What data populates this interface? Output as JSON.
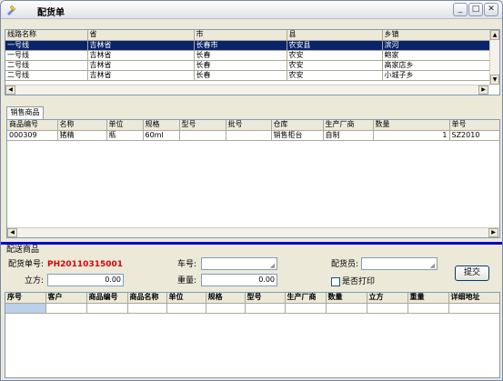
{
  "window": {
    "title": "配货单",
    "min": "_",
    "max": "□",
    "close": "✕"
  },
  "routes": {
    "columns": [
      "线路名称",
      "省",
      "市",
      "县",
      "乡镇"
    ],
    "rows": [
      [
        "一号线",
        "吉林省",
        "长春市",
        "农安县",
        "滨河"
      ],
      [
        "一号线",
        "吉林省",
        "长春",
        "农安",
        "鲍家"
      ],
      [
        "二号线",
        "吉林省",
        "长春",
        "农安",
        "高家店乡"
      ],
      [
        "二号线",
        "吉林省",
        "长春",
        "农安",
        "小城子乡"
      ]
    ],
    "selected_row": 0
  },
  "tab": {
    "label": "销售商品"
  },
  "products": {
    "columns": [
      "商品编号",
      "名称",
      "单位",
      "规格",
      "型号",
      "批号",
      "仓库",
      "生产厂商",
      "数量",
      "单号"
    ],
    "rows": [
      [
        "000309",
        "猪精",
        "瓶",
        "60ml",
        "",
        "",
        "销售柜台",
        "自制",
        "1",
        "SZ2010"
      ]
    ]
  },
  "delivery": {
    "section_label": "配送商品",
    "order_no_label": "配货单号:",
    "order_no": "PH20110315001",
    "truck_label": "车号:",
    "truck_value": "",
    "staff_label": "配货员:",
    "staff_value": "",
    "volume_label": "立方:",
    "volume_value": "0.00",
    "weight_label": "重量:",
    "weight_value": "0.00",
    "print_label": "是否打印",
    "submit_label": "提交"
  },
  "detail": {
    "columns": [
      "序号",
      "客户",
      "商品编号",
      "商品名称",
      "单位",
      "规格",
      "型号",
      "生产厂商",
      "数量",
      "立方",
      "重量",
      "详细地址"
    ]
  },
  "colors": {
    "selection": "#0a246a",
    "accent_bar": "#0000cc",
    "order_no": "#e00000"
  }
}
